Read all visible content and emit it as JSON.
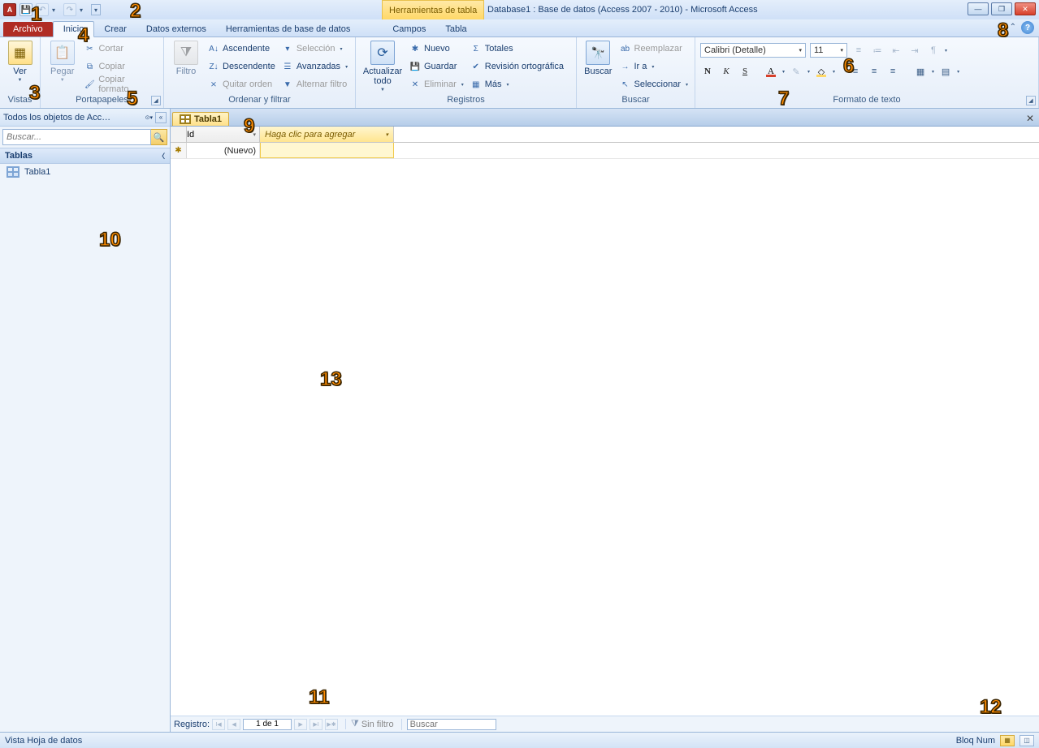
{
  "window": {
    "title": "Database1 : Base de datos (Access 2007 - 2010)  -  Microsoft Access",
    "contextual_tab_title": "Herramientas de tabla"
  },
  "tabs": {
    "file": "Archivo",
    "inicio": "Inicio",
    "crear": "Crear",
    "datos_externos": "Datos externos",
    "herramientas_bd": "Herramientas de base de datos",
    "campos": "Campos",
    "tabla": "Tabla"
  },
  "ribbon": {
    "vistas": {
      "ver": "Ver",
      "group_label": "Vistas"
    },
    "portapapeles": {
      "pegar": "Pegar",
      "cortar": "Cortar",
      "copiar": "Copiar",
      "copiar_formato": "Copiar formato",
      "group_label": "Portapapeles"
    },
    "ordenar": {
      "filtro": "Filtro",
      "asc": "Ascendente",
      "desc": "Descendente",
      "quitar": "Quitar orden",
      "seleccion": "Selección",
      "avanzadas": "Avanzadas",
      "alternar": "Alternar filtro",
      "group_label": "Ordenar y filtrar"
    },
    "registros": {
      "actualizar": "Actualizar\ntodo",
      "nuevo": "Nuevo",
      "guardar": "Guardar",
      "eliminar": "Eliminar",
      "totales": "Totales",
      "revision": "Revisión ortográfica",
      "mas": "Más",
      "group_label": "Registros"
    },
    "buscar": {
      "buscar": "Buscar",
      "reemplazar": "Reemplazar",
      "ir_a": "Ir a",
      "seleccionar": "Seleccionar",
      "group_label": "Buscar"
    },
    "texto": {
      "font": "Calibri (Detalle)",
      "size": "11",
      "group_label": "Formato de texto"
    }
  },
  "nav": {
    "header": "Todos los objetos de Acc…",
    "search_placeholder": "Buscar...",
    "section_tablas": "Tablas",
    "item_tabla1": "Tabla1"
  },
  "doc": {
    "tab_name": "Tabla1",
    "col_id": "Id",
    "col_add": "Haga clic para agregar",
    "row_new": "(Nuevo)"
  },
  "recordnav": {
    "label": "Registro:",
    "position": "1 de 1",
    "sin_filtro": "Sin filtro",
    "buscar": "Buscar"
  },
  "status": {
    "left": "Vista Hoja de datos",
    "bloq_num": "Bloq Num"
  },
  "annotations": {
    "n1": "1",
    "n2": "2",
    "n3": "3",
    "n4": "4",
    "n5": "5",
    "n6": "6",
    "n7": "7",
    "n8": "8",
    "n9": "9",
    "n10": "10",
    "n11": "11",
    "n12": "12",
    "n13": "13"
  }
}
